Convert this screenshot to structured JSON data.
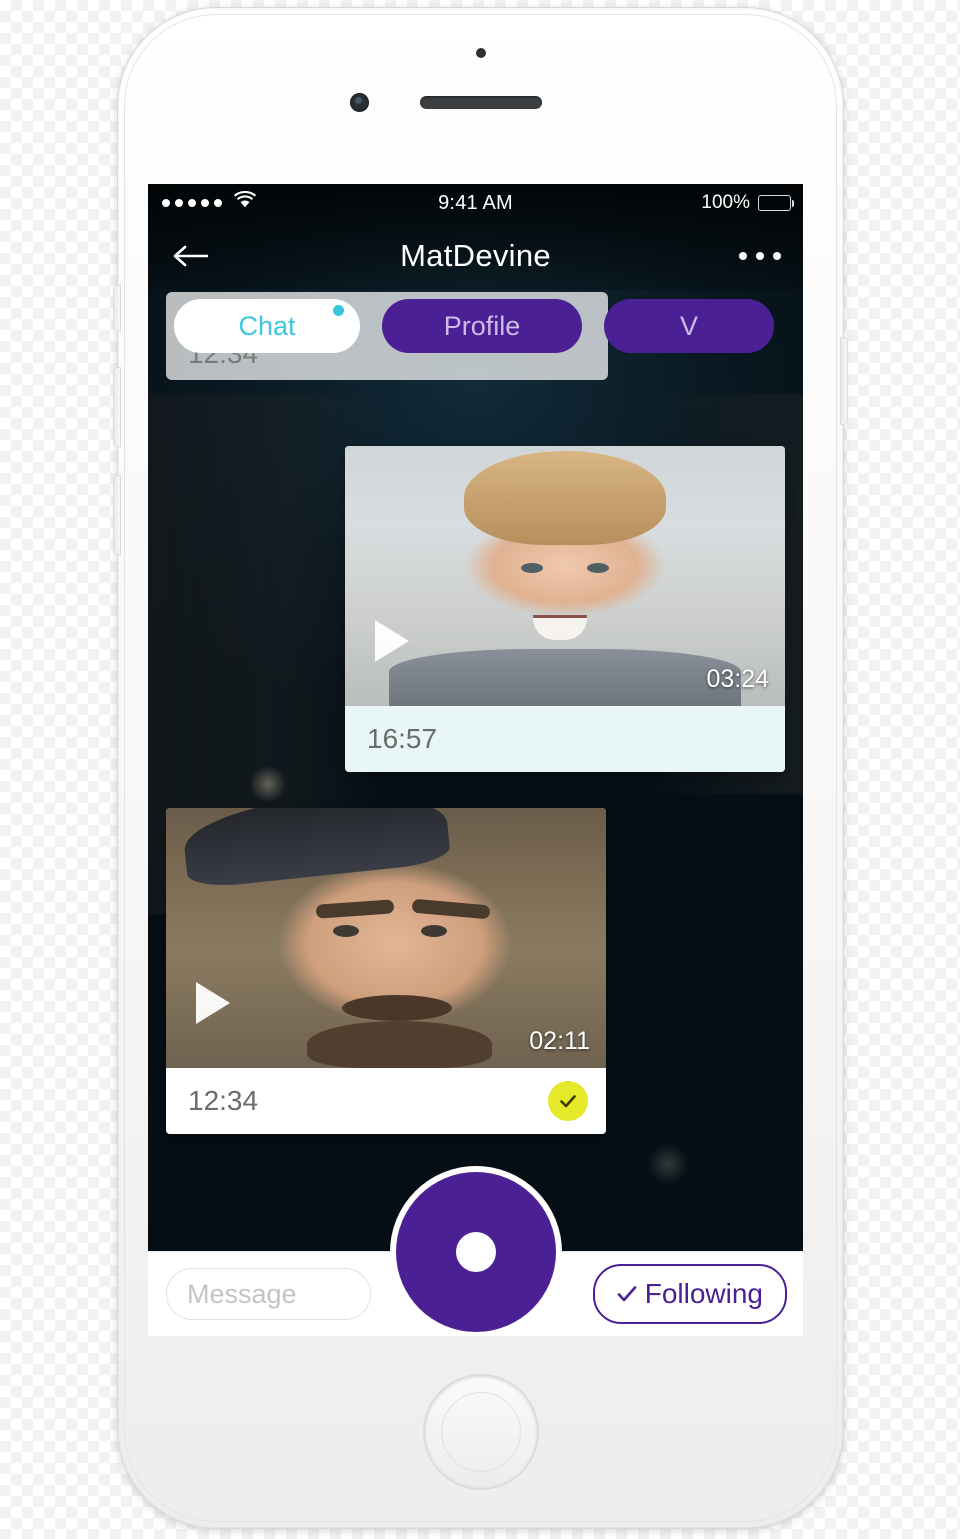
{
  "device": {
    "name": "white-smartphone-mockup",
    "speaker": "earpiece-speaker",
    "camera": "front-camera",
    "home": "home-button"
  },
  "status_bar": {
    "signal_dots": 5,
    "wifi_icon": "wifi-icon",
    "time": "9:41 AM",
    "battery_percent": "100%",
    "battery_icon": "battery-full-icon"
  },
  "nav": {
    "back_icon": "arrow-left-icon",
    "title": "MatDevine",
    "more_icon": "more-horizontal-icon"
  },
  "tabs": [
    {
      "label": "Chat",
      "active": true,
      "badge": true,
      "color": "#3ec7de"
    },
    {
      "label": "Profile",
      "active": false,
      "color": "#cdbbe8"
    },
    {
      "label": "V",
      "active": false,
      "color": "#cdbbe8"
    }
  ],
  "messages": {
    "partial_bubble_time": "12:34",
    "cards": [
      {
        "side": "right",
        "duration": "03:24",
        "time": "16:57",
        "play_icon": "play-icon",
        "has_check": false,
        "thumbnail": "woman-smiling-portrait"
      },
      {
        "side": "left",
        "duration": "02:11",
        "time": "12:34",
        "play_icon": "play-icon",
        "has_check": true,
        "check_icon": "check-circle-icon",
        "thumbnail": "man-with-hat-portrait"
      }
    ]
  },
  "composer": {
    "message_placeholder": "Message",
    "message_value": "",
    "record_button": "record-button",
    "following_label": "Following",
    "following_check_icon": "check-icon"
  },
  "colors": {
    "purple": "#4a2094",
    "cyan": "#3ec7de",
    "yellow": "#e4e92a",
    "white": "#ffffff"
  }
}
